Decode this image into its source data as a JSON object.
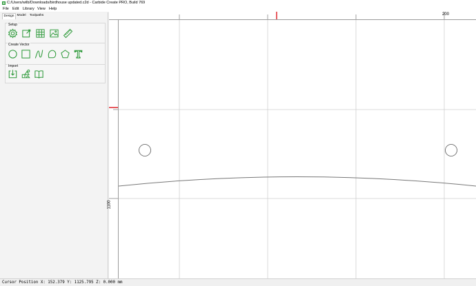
{
  "window": {
    "title": "C:/Users/wilb/Downloads/birdhouse updated.c2d - Carbide Create PRO, Build 769",
    "icon": "carbide-app-icon"
  },
  "menu": [
    "File",
    "Edit",
    "Library",
    "View",
    "Help"
  ],
  "tabs": [
    "Design",
    "Model",
    "Toolpaths"
  ],
  "active_tab": "Design",
  "sections": {
    "setup": {
      "label": "Setup",
      "tools": [
        "gear-icon",
        "edit-stock-icon",
        "grid-icon",
        "image-icon",
        "ruler-icon"
      ]
    },
    "create_vector": {
      "label": "Create Vector",
      "tools": [
        "circle-icon",
        "rectangle-icon",
        "curve-icon",
        "polygon-icon",
        "pentagon-icon",
        "text-icon"
      ]
    },
    "import": {
      "label": "Import",
      "tools": [
        "import-file-icon",
        "shapes-icon",
        "book-icon"
      ]
    }
  },
  "rulers": {
    "horizontal_label": "200",
    "vertical_label": "1100"
  },
  "status": {
    "text": "Cursor Position X: 152.379 Y: 1125.795 Z: 0.000 mm"
  },
  "colors": {
    "icon_green": "#2f9a3b",
    "grid_line": "#cfcfcf",
    "cursor_marker": "#e0242b",
    "shape_stroke": "#555555"
  }
}
